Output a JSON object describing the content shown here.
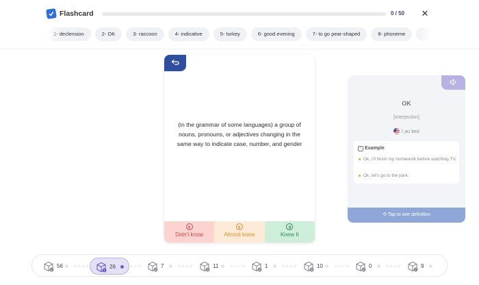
{
  "header": {
    "app_title": "Flashcard",
    "progress_text": "0 / 50",
    "progress_fraction": 0.0,
    "close_icon": "close-icon"
  },
  "word_tabs": [
    "1- declension",
    "2- OK",
    "3- raccoon",
    "4- indicative",
    "5- turkey",
    "6- good evening",
    "7- to go pear-shaped",
    "8- phoneme"
  ],
  "card": {
    "definition": "(in the grammar of some languages) a group of nouns, pronouns, or adjectives changing in the same way to indicate case, number, and gender",
    "flip_icon": "flip-icon",
    "answers": [
      {
        "label": "Didn't know",
        "icon": "sad-face-icon"
      },
      {
        "label": "Almost knew",
        "icon": "neutral-face-icon"
      },
      {
        "label": "Knew It",
        "icon": "happy-face-icon"
      }
    ]
  },
  "side_card": {
    "word": "OK",
    "part_of_speech": "[interjection]",
    "ipa": "/ˌəʊˈkeɪ/",
    "example_title": "Example",
    "examples": [
      "Ok, I'll finish my homework before watching TV.",
      "Ok, let's go to the park."
    ],
    "tap_label": "Tap to see definition",
    "speaker_icon": "speaker-icon"
  },
  "levels": [
    {
      "count": "56",
      "badge": "x",
      "active": false
    },
    {
      "count": "26",
      "badge": "1",
      "active": true
    },
    {
      "count": "7",
      "badge": "2",
      "active": false
    },
    {
      "count": "11",
      "badge": "3",
      "active": false
    },
    {
      "count": "1",
      "badge": "4",
      "active": false
    },
    {
      "count": "10",
      "badge": "5",
      "active": false
    },
    {
      "count": "0",
      "badge": "6",
      "active": false
    },
    {
      "count": "9",
      "badge": "✓",
      "active": false
    }
  ],
  "colors": {
    "accent": "#2f4f9e",
    "progress": "#5a67c9",
    "didnt": "#fcd3d1",
    "almost": "#fdebd7",
    "knew": "#cdeed9",
    "tap_bar": "#8ea7d8"
  }
}
